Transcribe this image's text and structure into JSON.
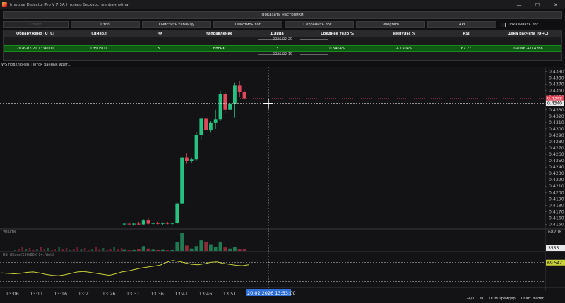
{
  "window": {
    "title": "Impulse Detector Pro V 7.5A (только бесхвостые фанпэйла)",
    "minimize_glyph": "—",
    "maximize_glyph": "☐",
    "close_glyph": "✕"
  },
  "settings_button": "Показать настройки",
  "toolbar": {
    "start": "Старт",
    "stop": "Стоп",
    "clear_table": "Очистить таблицу",
    "clear_log": "Очистить лог",
    "save_log": "Сохранить лог...",
    "telegram": "Telegram",
    "api": "API",
    "show_log": "Показывать лог"
  },
  "table": {
    "headers": [
      "Обнаружено (UTC)",
      "Символ",
      "ТФ",
      "Направление",
      "Длина",
      "Среднее тело %",
      "Импульс %",
      "RSI",
      "Цена расчёта (O→C)"
    ],
    "group1": "2026-02-20",
    "row": [
      "2026-02-20 13:40:00",
      "CYSUSDT",
      "5",
      "ВВЕРХ",
      "3",
      "0.5464%",
      "4.1504%",
      "67.27",
      "0.4096 → 0.4266"
    ],
    "group2": "2026-02-19"
  },
  "status": "WS подключен. Поток данных идёт...",
  "chart_data": {
    "type": "candlestick",
    "price_axis": [
      "0.4390",
      "0.4380",
      "0.4370",
      "0.4360",
      "0.4350",
      "0.4340",
      "0.4330",
      "0.4320",
      "0.4310",
      "0.4300",
      "0.4290",
      "0.4280",
      "0.4270",
      "0.4260",
      "0.4250",
      "0.4240",
      "0.4230",
      "0.4220",
      "0.4210",
      "0.4200",
      "0.4190",
      "0.4180",
      "0.4170",
      "0.4160",
      "0.4150"
    ],
    "ylim": [
      0.4145,
      0.4395
    ],
    "time_labels": [
      "13:06",
      "13:11",
      "13:16",
      "13:21",
      "13:26",
      "13:31",
      "13:36",
      "13:41",
      "13:46",
      "13:51"
    ],
    "current_price": "0.4348",
    "crosshair_price": "0.4340",
    "crosshair_time": "20.02.2026 13:53:00",
    "volume_label": "Volume",
    "volume_value": "68208",
    "volume_current": "3555",
    "rsi_label": "RSI (Close(250/80)) 14, Yield",
    "rsi_value": "69.542",
    "candles": [
      {
        "o": 0.415,
        "h": 0.4152,
        "l": 0.4148,
        "c": 0.4151
      },
      {
        "o": 0.4151,
        "h": 0.4153,
        "l": 0.4149,
        "c": 0.415
      },
      {
        "o": 0.415,
        "h": 0.4152,
        "l": 0.4148,
        "c": 0.4151
      },
      {
        "o": 0.4151,
        "h": 0.4154,
        "l": 0.4149,
        "c": 0.415
      },
      {
        "o": 0.415,
        "h": 0.4158,
        "l": 0.4149,
        "c": 0.4157
      },
      {
        "o": 0.4157,
        "h": 0.416,
        "l": 0.415,
        "c": 0.4151
      },
      {
        "o": 0.4151,
        "h": 0.4153,
        "l": 0.4149,
        "c": 0.4152
      },
      {
        "o": 0.4152,
        "h": 0.4154,
        "l": 0.415,
        "c": 0.4151
      },
      {
        "o": 0.4151,
        "h": 0.4153,
        "l": 0.4149,
        "c": 0.4152
      },
      {
        "o": 0.4152,
        "h": 0.4154,
        "l": 0.415,
        "c": 0.4151
      },
      {
        "o": 0.4151,
        "h": 0.4153,
        "l": 0.4149,
        "c": 0.4152
      },
      {
        "o": 0.4152,
        "h": 0.4185,
        "l": 0.415,
        "c": 0.4183
      },
      {
        "o": 0.4183,
        "h": 0.426,
        "l": 0.418,
        "c": 0.4255
      },
      {
        "o": 0.4255,
        "h": 0.4262,
        "l": 0.4245,
        "c": 0.425
      },
      {
        "o": 0.425,
        "h": 0.4255,
        "l": 0.4246,
        "c": 0.4252
      },
      {
        "o": 0.4252,
        "h": 0.4295,
        "l": 0.425,
        "c": 0.429
      },
      {
        "o": 0.429,
        "h": 0.4318,
        "l": 0.4282,
        "c": 0.4316
      },
      {
        "o": 0.4316,
        "h": 0.432,
        "l": 0.4295,
        "c": 0.4298
      },
      {
        "o": 0.4298,
        "h": 0.4312,
        "l": 0.4294,
        "c": 0.431
      },
      {
        "o": 0.431,
        "h": 0.433,
        "l": 0.43,
        "c": 0.4315
      },
      {
        "o": 0.4315,
        "h": 0.436,
        "l": 0.4312,
        "c": 0.4355
      },
      {
        "o": 0.4355,
        "h": 0.4358,
        "l": 0.4325,
        "c": 0.433
      },
      {
        "o": 0.433,
        "h": 0.4362,
        "l": 0.4325,
        "c": 0.434
      },
      {
        "o": 0.434,
        "h": 0.4372,
        "l": 0.4318,
        "c": 0.4368
      },
      {
        "o": 0.4368,
        "h": 0.4375,
        "l": 0.435,
        "c": 0.4358
      },
      {
        "o": 0.4358,
        "h": 0.436,
        "l": 0.4346,
        "c": 0.4348
      }
    ],
    "volumes": [
      0.05,
      0.03,
      0.04,
      0.08,
      0.25,
      0.12,
      0.06,
      0.04,
      0.05,
      0.03,
      0.04,
      0.45,
      0.95,
      0.28,
      0.12,
      0.25,
      0.55,
      0.45,
      0.35,
      0.22,
      0.48,
      0.18,
      0.12,
      0.2,
      0.1,
      0.08
    ],
    "rsi": [
      48,
      47,
      46,
      47,
      49,
      50,
      48,
      45,
      43,
      42,
      44,
      47,
      50,
      51,
      49,
      47,
      45,
      43,
      46,
      50,
      52,
      55,
      58,
      60,
      62,
      64,
      70,
      74,
      72,
      69,
      66,
      65,
      67,
      70,
      71,
      68,
      66,
      64,
      63,
      65
    ]
  },
  "bottom_bar": {
    "tz": "24/7",
    "dom": "DOM Трейдер",
    "chart": "Chart Trader"
  },
  "colors": {
    "up": "#26c281",
    "down": "#e0475b",
    "rsi": "#c8cf3a",
    "accent": "#2e6fd8"
  }
}
